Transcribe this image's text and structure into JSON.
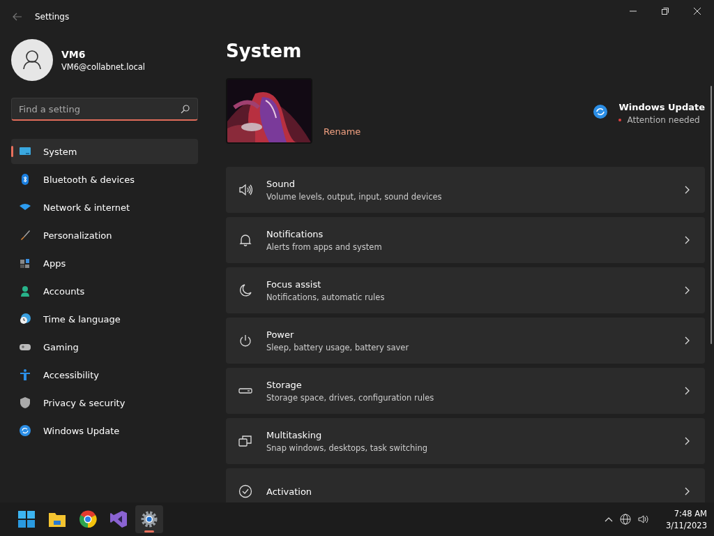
{
  "window": {
    "title": "Settings"
  },
  "account": {
    "name": "VM6",
    "email": "VM6@collabnet.local"
  },
  "search": {
    "placeholder": "Find a setting"
  },
  "sidebar": {
    "items": [
      {
        "label": "System",
        "kind": "system",
        "selected": true
      },
      {
        "label": "Bluetooth & devices",
        "kind": "bluetooth",
        "selected": false
      },
      {
        "label": "Network & internet",
        "kind": "network",
        "selected": false
      },
      {
        "label": "Personalization",
        "kind": "brush",
        "selected": false
      },
      {
        "label": "Apps",
        "kind": "apps",
        "selected": false
      },
      {
        "label": "Accounts",
        "kind": "accounts",
        "selected": false
      },
      {
        "label": "Time & language",
        "kind": "time",
        "selected": false
      },
      {
        "label": "Gaming",
        "kind": "gaming",
        "selected": false
      },
      {
        "label": "Accessibility",
        "kind": "accessibility",
        "selected": false
      },
      {
        "label": "Privacy & security",
        "kind": "privacy",
        "selected": false
      },
      {
        "label": "Windows Update",
        "kind": "update",
        "selected": false
      }
    ]
  },
  "page": {
    "title": "System",
    "rename": "Rename",
    "update": {
      "title": "Windows Update",
      "status": "Attention needed"
    },
    "cards": [
      {
        "title": "Sound",
        "subtitle": "Volume levels, output, input, sound devices",
        "kind": "sound"
      },
      {
        "title": "Notifications",
        "subtitle": "Alerts from apps and system",
        "kind": "bell"
      },
      {
        "title": "Focus assist",
        "subtitle": "Notifications, automatic rules",
        "kind": "moon"
      },
      {
        "title": "Power",
        "subtitle": "Sleep, battery usage, battery saver",
        "kind": "power"
      },
      {
        "title": "Storage",
        "subtitle": "Storage space, drives, configuration rules",
        "kind": "storage"
      },
      {
        "title": "Multitasking",
        "subtitle": "Snap windows, desktops, task switching",
        "kind": "multitask"
      },
      {
        "title": "Activation",
        "kind": "check"
      }
    ]
  },
  "taskbar": {
    "apps": [
      {
        "kind": "start",
        "selected": false
      },
      {
        "kind": "folder",
        "selected": false
      },
      {
        "kind": "browser",
        "selected": false
      },
      {
        "kind": "studio",
        "selected": false
      },
      {
        "kind": "gear",
        "selected": true
      }
    ],
    "time": "7:48 AM",
    "date": "3/11/2023"
  }
}
